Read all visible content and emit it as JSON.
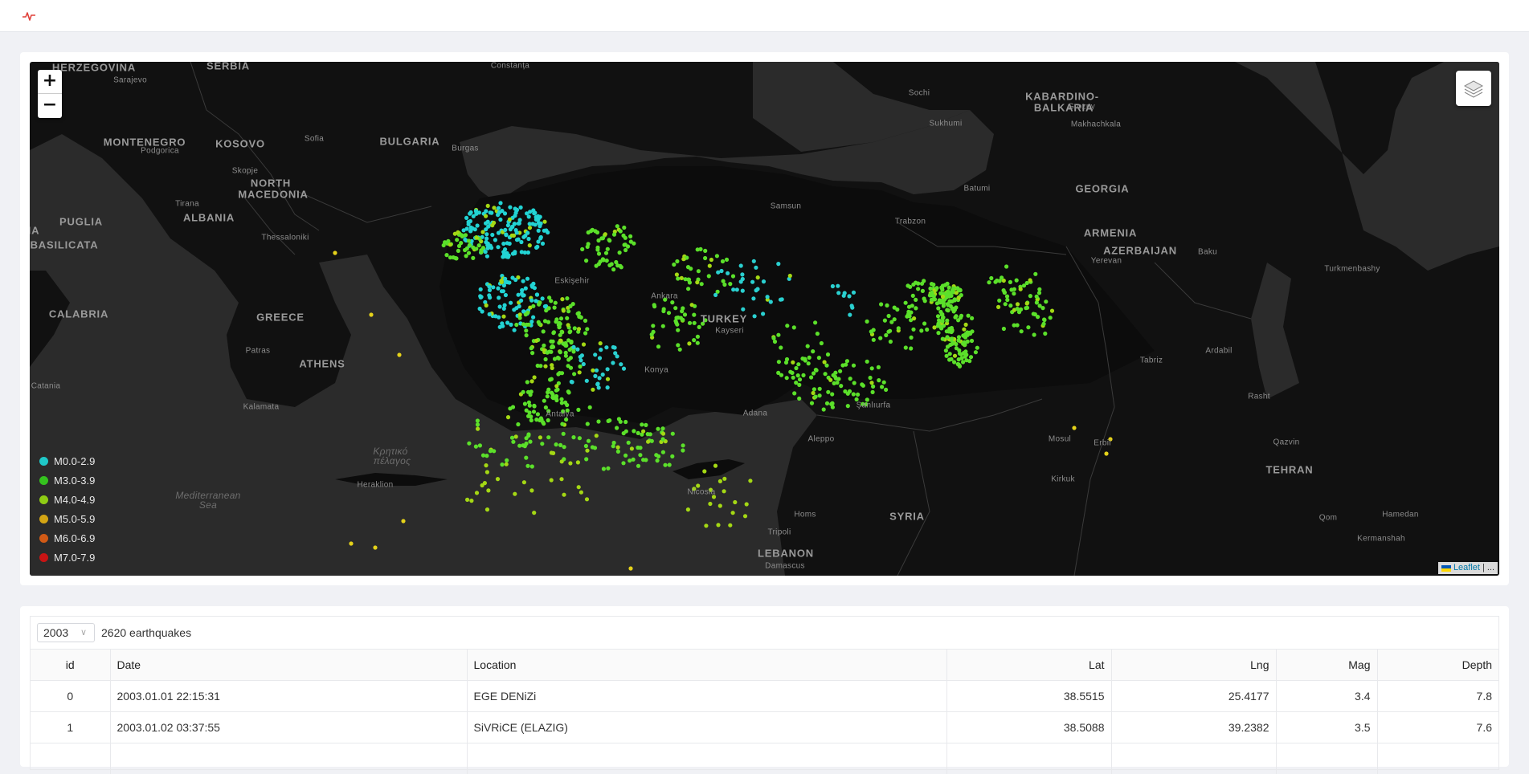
{
  "header": {
    "logo_icon": "activity-pulse-icon",
    "accent": "#e0403a"
  },
  "map": {
    "zoom_in_label": "+",
    "zoom_out_label": "−",
    "layers_icon": "layers-icon",
    "attribution": {
      "link": "Leaflet",
      "sep": "|",
      "more": "..."
    },
    "labels": [
      {
        "text": "HERZEGOVINA",
        "cls": "country"
      },
      {
        "text": "SERBIA",
        "cls": "country"
      },
      {
        "text": "Sarajevo",
        "cls": "city"
      },
      {
        "text": "Constanța",
        "cls": "city"
      },
      {
        "text": "MONTENEGRO",
        "cls": "country"
      },
      {
        "text": "KOSOVO",
        "cls": "country"
      },
      {
        "text": "Podgorica",
        "cls": "city"
      },
      {
        "text": "Sofia",
        "cls": "city"
      },
      {
        "text": "BULGARIA",
        "cls": "country"
      },
      {
        "text": "Burgas",
        "cls": "city"
      },
      {
        "text": "Skopje",
        "cls": "city"
      },
      {
        "text": "NORTH",
        "cls": "country"
      },
      {
        "text": "MACEDONIA",
        "cls": "country"
      },
      {
        "text": "Tirana",
        "cls": "city"
      },
      {
        "text": "ALBANIA",
        "cls": "country"
      },
      {
        "text": "PUGLIA",
        "cls": "country"
      },
      {
        "text": "Thessaloniki",
        "cls": "city"
      },
      {
        "text": "BASILICATA",
        "cls": "country"
      },
      {
        "text": "IA",
        "cls": "country"
      },
      {
        "text": "CALABRIA",
        "cls": "country"
      },
      {
        "text": "GREECE",
        "cls": "country"
      },
      {
        "text": "Patras",
        "cls": "city"
      },
      {
        "text": "ATHENS",
        "cls": "country"
      },
      {
        "text": "Catania",
        "cls": "city"
      },
      {
        "text": "Kalamata",
        "cls": "city"
      },
      {
        "text": "Κρητικό",
        "cls": "sea"
      },
      {
        "text": "πέλαγος",
        "cls": "sea"
      },
      {
        "text": "Heraklion",
        "cls": "city"
      },
      {
        "text": "Mediterranean",
        "cls": "sea"
      },
      {
        "text": "Sea",
        "cls": "sea"
      },
      {
        "text": "Sochi",
        "cls": "city"
      },
      {
        "text": "KABARDINO-",
        "cls": "country"
      },
      {
        "text": "BALKARIA",
        "cls": "country"
      },
      {
        "text": "Grozny",
        "cls": "city"
      },
      {
        "text": "Sukhumi",
        "cls": "city"
      },
      {
        "text": "Makhachkala",
        "cls": "city"
      },
      {
        "text": "Samsun",
        "cls": "city"
      },
      {
        "text": "Batumi",
        "cls": "city"
      },
      {
        "text": "GEORGIA",
        "cls": "country"
      },
      {
        "text": "Trabzon",
        "cls": "city"
      },
      {
        "text": "ARMENIA",
        "cls": "country"
      },
      {
        "text": "Yerevan",
        "cls": "city"
      },
      {
        "text": "AZERBAIJAN",
        "cls": "country"
      },
      {
        "text": "Baku",
        "cls": "city"
      },
      {
        "text": "Turkmenbashy",
        "cls": "city"
      },
      {
        "text": "Eskişehir",
        "cls": "city"
      },
      {
        "text": "Ankara",
        "cls": "city"
      },
      {
        "text": "TURKEY",
        "cls": "country"
      },
      {
        "text": "Kayseri",
        "cls": "city"
      },
      {
        "text": "Konya",
        "cls": "city"
      },
      {
        "text": "Antalya",
        "cls": "city"
      },
      {
        "text": "Adana",
        "cls": "city"
      },
      {
        "text": "Şanlıurfa",
        "cls": "city"
      },
      {
        "text": "Aleppo",
        "cls": "city"
      },
      {
        "text": "Tabriz",
        "cls": "city"
      },
      {
        "text": "Ardabil",
        "cls": "city"
      },
      {
        "text": "Rasht",
        "cls": "city"
      },
      {
        "text": "Mosul",
        "cls": "city"
      },
      {
        "text": "Erbil",
        "cls": "city"
      },
      {
        "text": "Qazvin",
        "cls": "city"
      },
      {
        "text": "Kirkuk",
        "cls": "city"
      },
      {
        "text": "TEHRAN",
        "cls": "country"
      },
      {
        "text": "Nicosia",
        "cls": "city"
      },
      {
        "text": "Homs",
        "cls": "city"
      },
      {
        "text": "SYRIA",
        "cls": "country"
      },
      {
        "text": "Tripoli",
        "cls": "city"
      },
      {
        "text": "Hamedan",
        "cls": "city"
      },
      {
        "text": "Qom",
        "cls": "city"
      },
      {
        "text": "Kermanshah",
        "cls": "city"
      },
      {
        "text": "LEBANON",
        "cls": "country"
      },
      {
        "text": "Damascus",
        "cls": "city"
      }
    ],
    "legend": [
      {
        "label": "M0.0-2.9",
        "color": "#1fc8c8"
      },
      {
        "label": "M3.0-3.9",
        "color": "#35c21e"
      },
      {
        "label": "M4.0-4.9",
        "color": "#8fcc14"
      },
      {
        "label": "M5.0-5.9",
        "color": "#d4a514"
      },
      {
        "label": "M6.0-6.9",
        "color": "#d15a16"
      },
      {
        "label": "M7.0-7.9",
        "color": "#c81414"
      }
    ]
  },
  "table": {
    "year": "2003",
    "count_text": "2620 earthquakes",
    "columns": [
      "id",
      "Date",
      "Location",
      "Lat",
      "Lng",
      "Mag",
      "Depth"
    ],
    "rows": [
      {
        "id": "0",
        "date": "2003.01.01 22:15:31",
        "location": "EGE DENiZi",
        "lat": "38.5515",
        "lng": "25.4177",
        "mag": "3.4",
        "depth": "7.8"
      },
      {
        "id": "1",
        "date": "2003.01.02 03:37:55",
        "location": "SiVRiCE (ELAZIG)",
        "lat": "38.5088",
        "lng": "39.2382",
        "mag": "3.5",
        "depth": "7.6"
      },
      {
        "id": "",
        "date": "",
        "location": "",
        "lat": "",
        "lng": "",
        "mag": "",
        "depth": ""
      }
    ]
  }
}
